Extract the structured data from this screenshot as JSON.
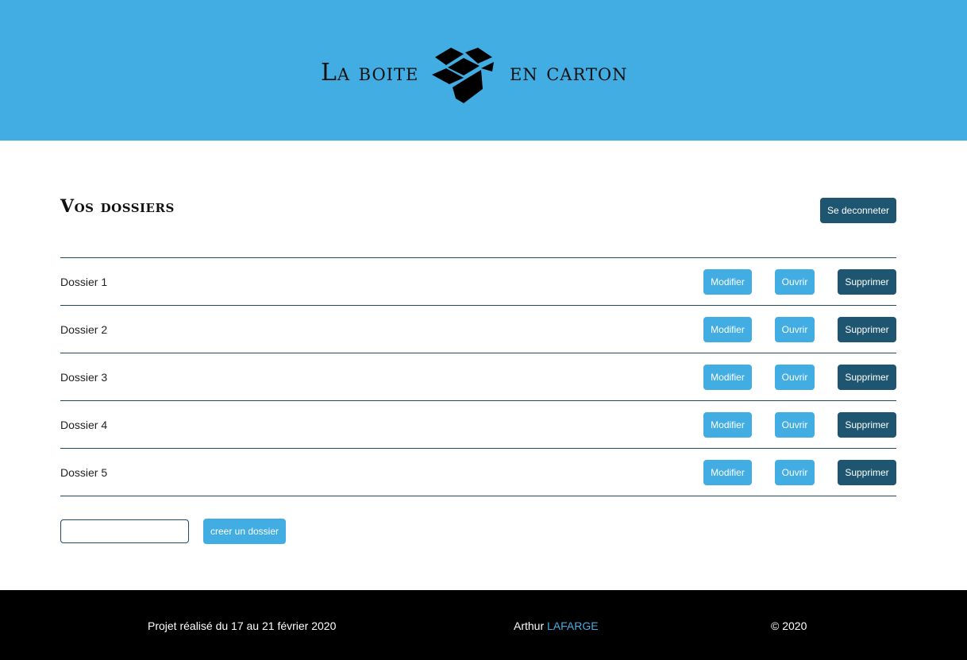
{
  "header": {
    "brand_left": "La boite",
    "brand_right": "en carton",
    "logo_icon": "open-box-icon",
    "background": "#42ade2"
  },
  "main": {
    "title": "Vos dossiers",
    "logout_label": "Se deconneter",
    "folders": [
      {
        "name": "Dossier 1",
        "modify": "Modifier",
        "open": "Ouvrir",
        "delete": "Supprimer"
      },
      {
        "name": "Dossier 2",
        "modify": "Modifier",
        "open": "Ouvrir",
        "delete": "Supprimer"
      },
      {
        "name": "Dossier 3",
        "modify": "Modifier",
        "open": "Ouvrir",
        "delete": "Supprimer"
      },
      {
        "name": "Dossier 4",
        "modify": "Modifier",
        "open": "Ouvrir",
        "delete": "Supprimer"
      },
      {
        "name": "Dossier 5",
        "modify": "Modifier",
        "open": "Ouvrir",
        "delete": "Supprimer"
      }
    ],
    "new_folder_input_value": "",
    "create_label": "creer un dossier"
  },
  "footer": {
    "project": "Projet réalisé du 17 au 21 février 2020",
    "author_first": "Arthur",
    "author_last": "LAFARGE",
    "copyright": "© 2020"
  },
  "colors": {
    "accent": "#42ade2",
    "dark": "#1e5570",
    "footer_bg": "#000000"
  }
}
